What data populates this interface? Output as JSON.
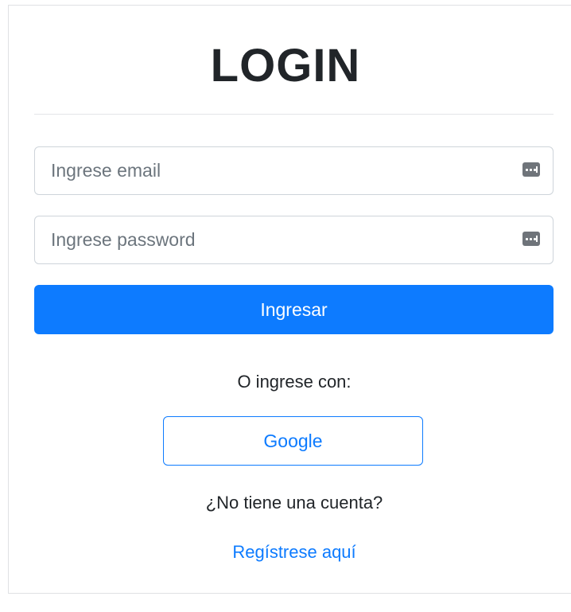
{
  "form": {
    "title": "LOGIN",
    "email": {
      "value": "",
      "placeholder": "Ingrese email",
      "icon": "password-manager-key-icon"
    },
    "password": {
      "value": "",
      "placeholder": "Ingrese password",
      "icon": "password-manager-key-icon"
    },
    "submit_label": "Ingresar"
  },
  "alternate": {
    "prompt": "O ingrese con:",
    "google_label": "Google"
  },
  "signup": {
    "question": "¿No tiene una cuenta?",
    "link_label": "Regístrese aquí"
  },
  "colors": {
    "primary": "#0d7bff",
    "text": "#212529",
    "border": "#ced4da"
  }
}
